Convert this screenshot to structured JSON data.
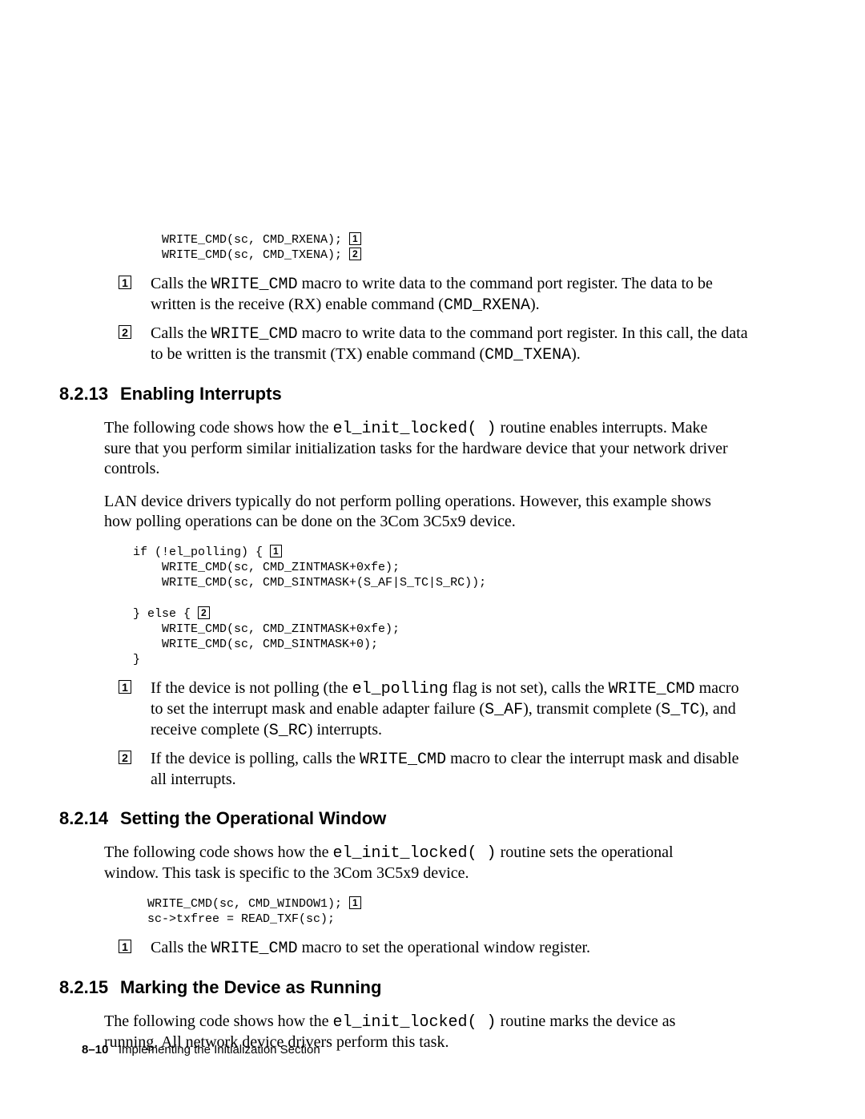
{
  "code1": {
    "l1a": "    WRITE_CMD(sc, CMD_RXENA); ",
    "l1b": "1",
    "l2a": "    WRITE_CMD(sc, CMD_TXENA); ",
    "l2b": "2"
  },
  "annot1": {
    "n1": "1",
    "b1a": "Calls the ",
    "b1b": "WRITE_CMD",
    "b1c": " macro to write data to the command port register. The data to be written is the receive (RX) enable command (",
    "b1d": "CMD_RXENA",
    "b1e": ").",
    "n2": "2",
    "b2a": "Calls the ",
    "b2b": "WRITE_CMD",
    "b2c": " macro to write data to the command port register. In this call, the data to be written is the transmit (TX) enable command (",
    "b2d": "CMD_TXENA",
    "b2e": ")."
  },
  "sec13": {
    "num": "8.2.13",
    "title": "Enabling Interrupts"
  },
  "p13a_a": "The following code shows how the ",
  "p13a_b": "el_init_locked( )",
  "p13a_c": " routine enables interrupts. Make sure that you perform similar initialization tasks for the hardware device that your network driver controls.",
  "p13b": "LAN device drivers typically do not perform polling operations. However, this example shows how polling operations can be done on the 3Com 3C5x9 device.",
  "code2": {
    "l1a": "if (!el_polling) { ",
    "l1b": "1",
    "l2": "    WRITE_CMD(sc, CMD_ZINTMASK+0xfe);",
    "l3": "    WRITE_CMD(sc, CMD_SINTMASK+(S_AF|S_TC|S_RC));",
    "l4": "",
    "l5a": "} else { ",
    "l5b": "2",
    "l6": "    WRITE_CMD(sc, CMD_ZINTMASK+0xfe);",
    "l7": "    WRITE_CMD(sc, CMD_SINTMASK+0);",
    "l8": "}"
  },
  "annot2": {
    "n1": "1",
    "b1a": "If the device is not polling (the ",
    "b1b": "el_polling",
    "b1c": " flag is not set), calls the ",
    "b1d": "WRITE_CMD",
    "b1e": " macro to set the interrupt mask and enable adapter failure (",
    "b1f": "S_AF",
    "b1g": "), transmit complete (",
    "b1h": "S_TC",
    "b1i": "), and receive complete (",
    "b1j": "S_RC",
    "b1k": ") interrupts.",
    "n2": "2",
    "b2a": "If the device is polling, calls the ",
    "b2b": "WRITE_CMD",
    "b2c": " macro to clear the interrupt mask and disable all interrupts."
  },
  "sec14": {
    "num": "8.2.14",
    "title": "Setting the Operational Window"
  },
  "p14_a": "The following code shows how the ",
  "p14_b": "el_init_locked( )",
  "p14_c": " routine sets the operational window. This task is specific to the 3Com 3C5x9 device.",
  "code3": {
    "l1a": "  WRITE_CMD(sc, CMD_WINDOW1); ",
    "l1b": "1",
    "l2": "  sc->txfree = READ_TXF(sc);"
  },
  "annot3": {
    "n1": "1",
    "b1a": "Calls the ",
    "b1b": "WRITE_CMD",
    "b1c": " macro to set the operational window register."
  },
  "sec15": {
    "num": "8.2.15",
    "title": "Marking the Device as Running"
  },
  "p15_a": "The following code shows how the ",
  "p15_b": "el_init_locked( )",
  "p15_c": " routine marks the device as running. All network device drivers perform this task.",
  "footer": {
    "page": "8–10",
    "chapter": "Implementing the Initialization Section"
  }
}
